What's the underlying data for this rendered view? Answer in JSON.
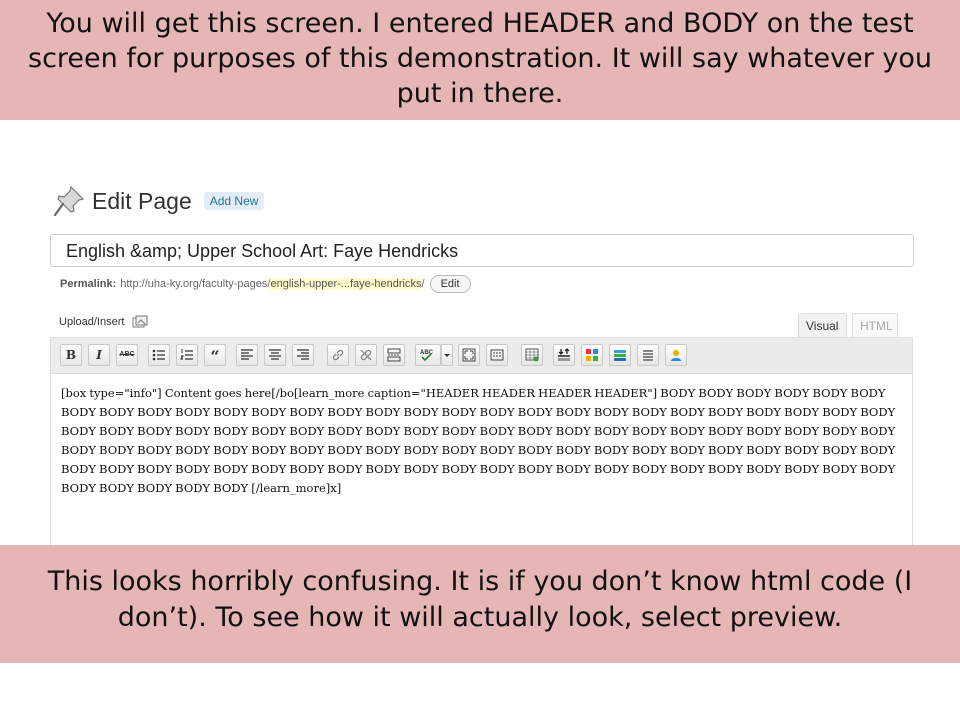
{
  "slide": {
    "top_text": "You will get this screen.  I entered HEADER and BODY on the test screen for purposes of this demonstration.  It will say whatever you put in there.",
    "bottom_text": "This looks horribly confusing.  It is if you don’t know html code (I don’t).  To see how it will actually look, select preview."
  },
  "header": {
    "title": "Edit Page",
    "add_new_label": "Add New"
  },
  "title_field": {
    "value": "English &amp; Upper School Art: Faye Hendricks"
  },
  "permalink": {
    "label": "Permalink:",
    "base_url": "http://uha-ky.org/faculty-pages/",
    "slug": "english-upper-...faye-hendricks",
    "trailing": "/",
    "edit_label": "Edit"
  },
  "upload": {
    "label": "Upload/Insert"
  },
  "tabs": {
    "visual": "Visual",
    "html": "HTML"
  },
  "toolbar": {
    "bold": "B",
    "italic": "I",
    "strike": "ABC"
  },
  "editor": {
    "content": "[box type=\"info\"] Content goes here[/bo[learn_more caption=\"HEADER HEADER HEADER HEADER\"] BODY BODY BODY BODY BODY BODY BODY BODY BODY BODY BODY BODY BODY BODY BODY BODY BODY BODY BODY BODY BODY BODY BODY BODY BODY BODY BODY BODY BODY BODY BODY BODY BODY BODY BODY BODY BODY BODY BODY BODY BODY BODY BODY BODY BODY BODY BODY BODY BODY BODY BODY BODY BODY BODY BODY BODY BODY BODY BODY BODY BODY BODY BODY BODY BODY BODY BODY BODY BODY BODY BODY BODY BODY BODY BODY BODY BODY BODY BODY BODY BODY BODY BODY BODY BODY BODY BODY BODY BODY BODY BODY BODY BODY BODY BODY BODY BODY BODY BODY [/learn_more]x]"
  },
  "colors": {
    "banner_bg": "#e6b6b6",
    "link_blue": "#21759b",
    "slug_highlight": "#fffbcc"
  }
}
